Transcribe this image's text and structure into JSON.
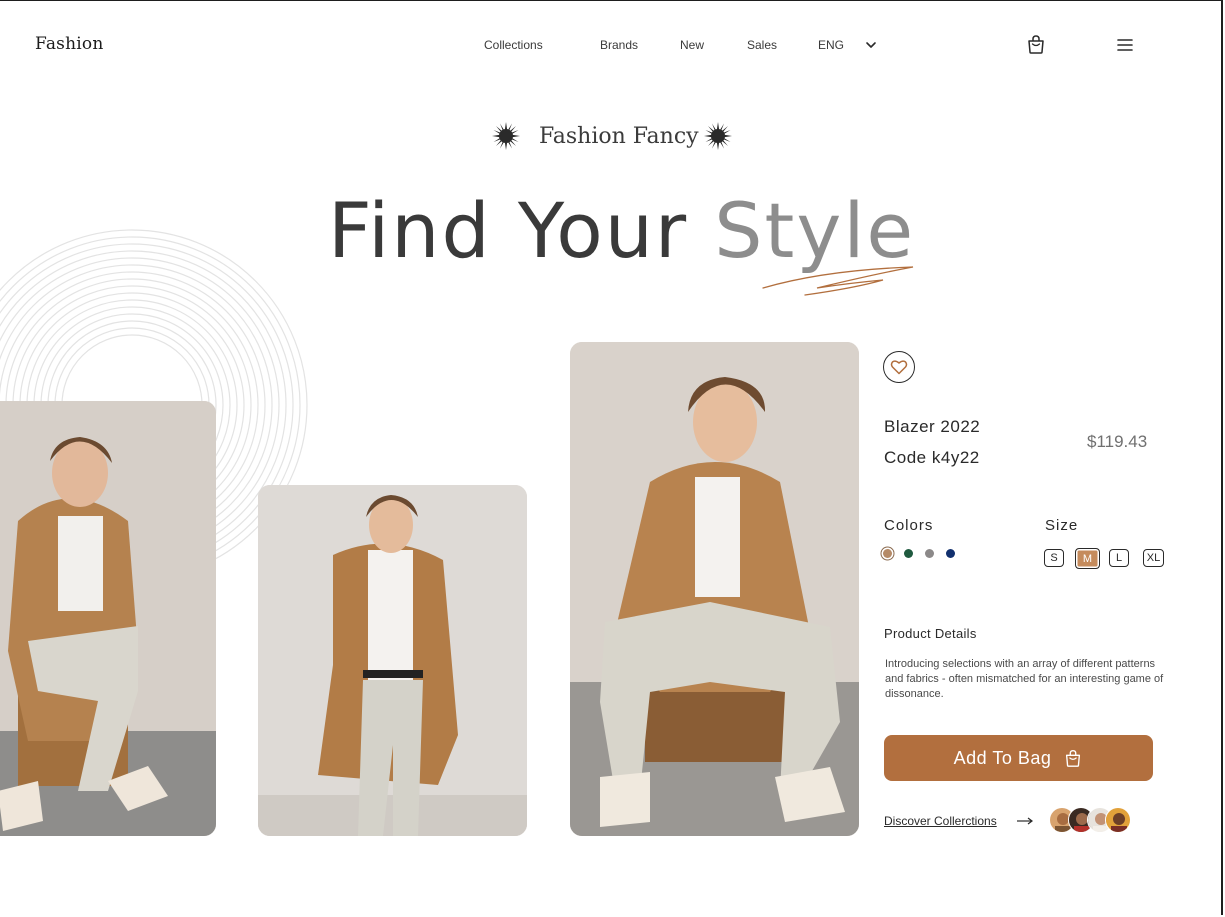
{
  "brand": {
    "logo": "Fashion"
  },
  "nav": {
    "links": [
      "Collections",
      "Brands",
      "New",
      "Sales"
    ],
    "language": "ENG"
  },
  "icons": {
    "language_toggle": "chevron-down-icon",
    "bag": "shopping-bag-icon",
    "menu": "hamburger-menu-icon",
    "favorite": "heart-icon",
    "discover_arrow": "arrow-right-icon"
  },
  "hero": {
    "subtitle": "Fashion Fancy",
    "headline_part1": "Find Your",
    "headline_part2": "Style"
  },
  "product": {
    "name": "Blazer  2022",
    "code": "Code  k4y22",
    "price": "$119.43",
    "colors_label": "Colors",
    "colors": [
      "#b58a67",
      "#1f5a3f",
      "#8c8989",
      "#12306e"
    ],
    "selected_color_index": 0,
    "size_label": "Size",
    "sizes": [
      "S",
      "M",
      "L",
      "XL"
    ],
    "selected_size": "M",
    "details_title": "Product Details",
    "details_text": "Introducing selections with an array of different patterns and fabrics - often mismatched for an interesting game of dissonance.",
    "add_to_bag": "Add To Bag",
    "discover_link": "Discover Collerctions"
  },
  "theme": {
    "accent": "#b26f3e",
    "accent_light": "#c58b5c",
    "muted_text": "#8d8d8d"
  }
}
